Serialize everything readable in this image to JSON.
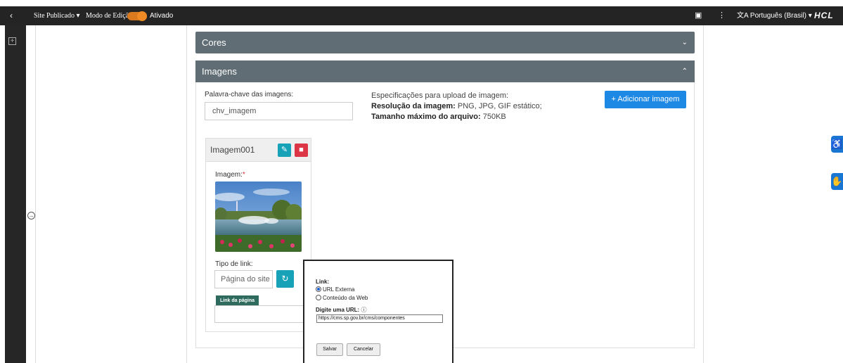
{
  "topbar": {
    "back_icon": "‹",
    "site_status": "Site Publicado ▾",
    "edit_mode_label": "Modo de Edição:",
    "edit_mode_value": "Ativado",
    "panel_icon": "▣",
    "more_icon": "⋮",
    "language": "文A Português (Brasil) ▾",
    "brand": "HCL"
  },
  "accordion": {
    "cores_label": "Cores",
    "imagens_label": "Imagens",
    "chevron_down": "⌄",
    "chevron_up": "⌃"
  },
  "images_section": {
    "keyword_label": "Palavra-chave das imagens:",
    "keyword_value": "chv_imagem",
    "spec_title": "Especificações para upload de imagem:",
    "resolution_label": "Resolução da imagem:",
    "resolution_value": " PNG, JPG, GIF estático;",
    "max_size_label": "Tamanho máximo do arquivo:",
    "max_size_value": " 750KB",
    "add_button": "+ Adicionar imagem"
  },
  "image_card": {
    "title": "Imagem001",
    "image_label": "Imagem:",
    "required_mark": "*",
    "link_type_label": "Tipo de link:",
    "link_type_value": "Página do site",
    "link_tag": "Link da página"
  },
  "popup": {
    "link_label": "Link:",
    "option_external": "URL Externa",
    "option_web": "Conteúdo da Web",
    "url_label": "Digite uma URL:",
    "url_value": "https://cms.sp.gov.br/cms/componentes",
    "save": "Salvar",
    "cancel": "Cancelar"
  },
  "colors": {
    "accordion": "#616d75",
    "primary": "#1e88e5",
    "toggle": "#f08a24",
    "edit": "#17a2b8",
    "delete": "#dc3545"
  }
}
